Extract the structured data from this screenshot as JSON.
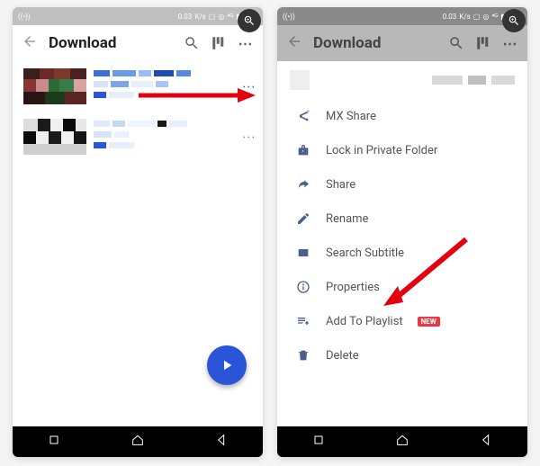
{
  "status": {
    "time": "0.03",
    "kbps": "K/s"
  },
  "toolbar": {
    "title": "Download"
  },
  "fab": {
    "label": "play"
  },
  "menu": {
    "items": [
      {
        "label": "MX Share",
        "icon": "share-plus-icon"
      },
      {
        "label": "Lock in Private Folder",
        "icon": "lock-icon"
      },
      {
        "label": "Share",
        "icon": "share-arrow-icon"
      },
      {
        "label": "Rename",
        "icon": "pencil-icon"
      },
      {
        "label": "Search Subtitle",
        "icon": "subtitle-icon"
      },
      {
        "label": "Properties",
        "icon": "info-icon"
      },
      {
        "label": "Add To Playlist",
        "icon": "playlist-add-icon",
        "badge": "NEW"
      },
      {
        "label": "Delete",
        "icon": "trash-icon"
      }
    ]
  }
}
